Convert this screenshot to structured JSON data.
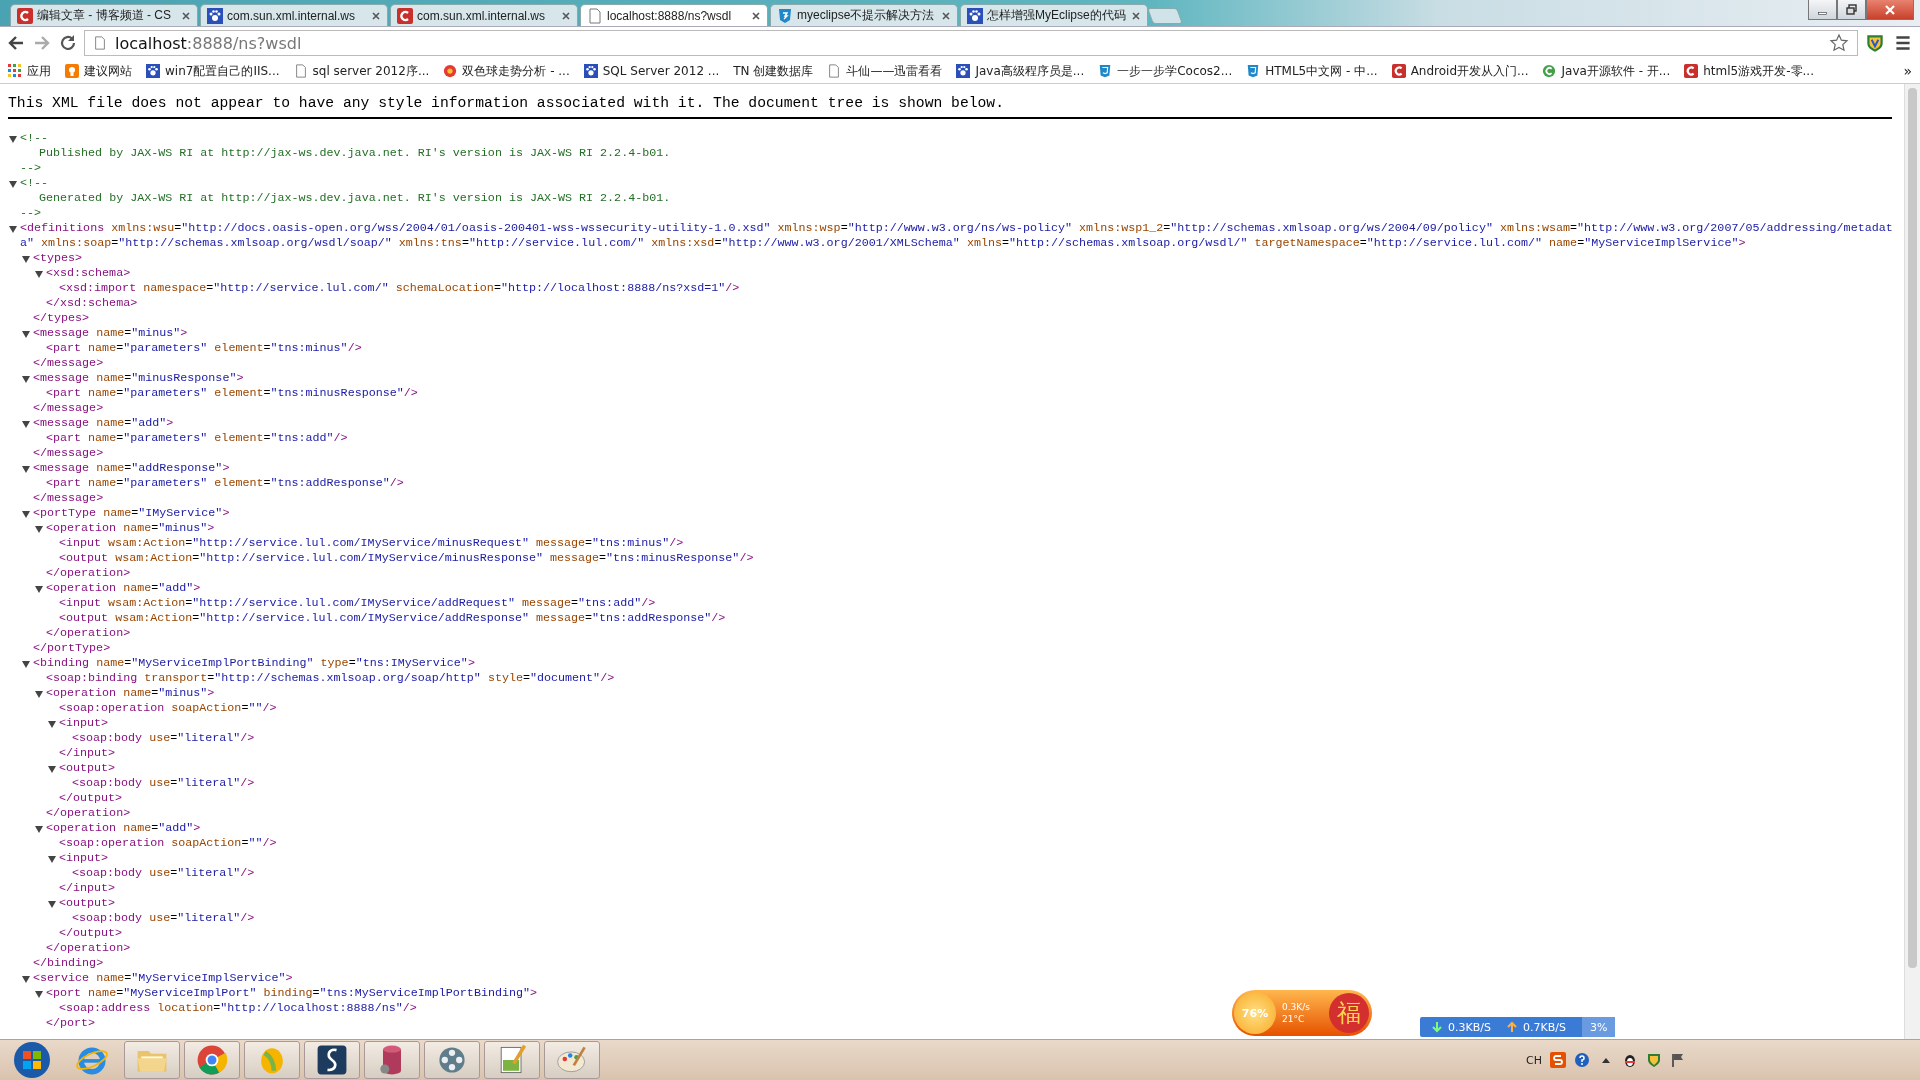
{
  "tabs": [
    {
      "title": "编辑文章 - 博客频道 - CS",
      "kind": "red-c",
      "selected": false
    },
    {
      "title": "com.sun.xml.internal.ws",
      "kind": "paw",
      "selected": false
    },
    {
      "title": "com.sun.xml.internal.ws",
      "kind": "red-c",
      "selected": false
    },
    {
      "title": "localhost:8888/ns?wsdl",
      "kind": "page",
      "selected": true
    },
    {
      "title": "myeclipse不提示解决方法",
      "kind": "blue-3",
      "selected": false
    },
    {
      "title": "怎样增强MyEclipse的代码",
      "kind": "paw",
      "selected": false
    }
  ],
  "address": {
    "host": "localhost",
    "rest": ":8888/ns?wsdl"
  },
  "bookmarks": [
    {
      "label": "应用",
      "kind": "apps"
    },
    {
      "label": "建议网站",
      "kind": "bulb"
    },
    {
      "label": "win7配置自己的IIS...",
      "kind": "paw"
    },
    {
      "label": "sql server 2012序...",
      "kind": "page"
    },
    {
      "label": "双色球走势分析 - ...",
      "kind": "ball"
    },
    {
      "label": "SQL Server 2012 ...",
      "kind": "paw"
    },
    {
      "label": "TN 创建数据库",
      "kind": "none"
    },
    {
      "label": "斗仙——迅雷看看",
      "kind": "page"
    },
    {
      "label": "Java高级程序员是...",
      "kind": "paw"
    },
    {
      "label": "一步一步学Cocos2...",
      "kind": "html5"
    },
    {
      "label": "HTML5中文网 - 中...",
      "kind": "html5"
    },
    {
      "label": "Android开发从入门...",
      "kind": "red-c"
    },
    {
      "label": "Java开源软件 - 开...",
      "kind": "green-c"
    },
    {
      "label": "html5游戏开发-零...",
      "kind": "red-c"
    }
  ],
  "bookmarks_more": "»",
  "notice": "This XML file does not appear to have any style information associated with it. The document tree is shown below.",
  "xml": [
    {
      "kind": "comment",
      "expanded": true,
      "open": "<!--",
      "text": "Published by JAX-WS RI at http://jax-ws.dev.java.net. RI's version is JAX-WS RI 2.2.4-b01.",
      "close": "-->"
    },
    {
      "kind": "comment",
      "expanded": true,
      "open": "<!--",
      "text": "Generated by JAX-WS RI at http://jax-ws.dev.java.net. RI's version is JAX-WS RI 2.2.4-b01.",
      "close": "-->"
    },
    {
      "kind": "element",
      "expanded": true,
      "open": "<definitions xmlns:wsu=\"http://docs.oasis-open.org/wss/2004/01/oasis-200401-wss-wssecurity-utility-1.0.xsd\" xmlns:wsp=\"http://www.w3.org/ns/ws-policy\" xmlns:wsp1_2=\"http://schemas.xmlsoap.org/ws/2004/09/policy\" xmlns:wsam=\"http://www.w3.org/2007/05/addressing/metadata\" xmlns:soap=\"http://schemas.xmlsoap.org/wsdl/soap/\" xmlns:tns=\"http://service.lul.com/\" xmlns:xsd=\"http://www.w3.org/2001/XMLSchema\" xmlns=\"http://schemas.xmlsoap.org/wsdl/\" targetNamespace=\"http://service.lul.com/\" name=\"MyServiceImplService\">",
      "children": [
        {
          "kind": "element",
          "expanded": true,
          "open": "<types>",
          "close": "</types>",
          "children": [
            {
              "kind": "element",
              "expanded": true,
              "open": "<xsd:schema>",
              "close": "</xsd:schema>",
              "children": [
                {
                  "kind": "leaf",
                  "text": "<xsd:import namespace=\"http://service.lul.com/\" schemaLocation=\"http://localhost:8888/ns?xsd=1\"/>"
                }
              ]
            }
          ]
        },
        {
          "kind": "element",
          "expanded": true,
          "open": "<message name=\"minus\">",
          "close": "</message>",
          "children": [
            {
              "kind": "leaf",
              "text": "<part name=\"parameters\" element=\"tns:minus\"/>"
            }
          ]
        },
        {
          "kind": "element",
          "expanded": true,
          "open": "<message name=\"minusResponse\">",
          "close": "</message>",
          "children": [
            {
              "kind": "leaf",
              "text": "<part name=\"parameters\" element=\"tns:minusResponse\"/>"
            }
          ]
        },
        {
          "kind": "element",
          "expanded": true,
          "open": "<message name=\"add\">",
          "close": "</message>",
          "children": [
            {
              "kind": "leaf",
              "text": "<part name=\"parameters\" element=\"tns:add\"/>"
            }
          ]
        },
        {
          "kind": "element",
          "expanded": true,
          "open": "<message name=\"addResponse\">",
          "close": "</message>",
          "children": [
            {
              "kind": "leaf",
              "text": "<part name=\"parameters\" element=\"tns:addResponse\"/>"
            }
          ]
        },
        {
          "kind": "element",
          "expanded": true,
          "open": "<portType name=\"IMyService\">",
          "close": "</portType>",
          "children": [
            {
              "kind": "element",
              "expanded": true,
              "open": "<operation name=\"minus\">",
              "close": "</operation>",
              "children": [
                {
                  "kind": "leaf",
                  "text": "<input wsam:Action=\"http://service.lul.com/IMyService/minusRequest\" message=\"tns:minus\"/>"
                },
                {
                  "kind": "leaf",
                  "text": "<output wsam:Action=\"http://service.lul.com/IMyService/minusResponse\" message=\"tns:minusResponse\"/>"
                }
              ]
            },
            {
              "kind": "element",
              "expanded": true,
              "open": "<operation name=\"add\">",
              "close": "</operation>",
              "children": [
                {
                  "kind": "leaf",
                  "text": "<input wsam:Action=\"http://service.lul.com/IMyService/addRequest\" message=\"tns:add\"/>"
                },
                {
                  "kind": "leaf",
                  "text": "<output wsam:Action=\"http://service.lul.com/IMyService/addResponse\" message=\"tns:addResponse\"/>"
                }
              ]
            }
          ]
        },
        {
          "kind": "element",
          "expanded": true,
          "open": "<binding name=\"MyServiceImplPortBinding\" type=\"tns:IMyService\">",
          "close": "</binding>",
          "children": [
            {
              "kind": "leaf",
              "text": "<soap:binding transport=\"http://schemas.xmlsoap.org/soap/http\" style=\"document\"/>"
            },
            {
              "kind": "element",
              "expanded": true,
              "open": "<operation name=\"minus\">",
              "close": "</operation>",
              "children": [
                {
                  "kind": "leaf",
                  "text": "<soap:operation soapAction=\"\"/>"
                },
                {
                  "kind": "element",
                  "expanded": true,
                  "open": "<input>",
                  "close": "</input>",
                  "children": [
                    {
                      "kind": "leaf",
                      "text": "<soap:body use=\"literal\"/>"
                    }
                  ]
                },
                {
                  "kind": "element",
                  "expanded": true,
                  "open": "<output>",
                  "close": "</output>",
                  "children": [
                    {
                      "kind": "leaf",
                      "text": "<soap:body use=\"literal\"/>"
                    }
                  ]
                }
              ]
            },
            {
              "kind": "element",
              "expanded": true,
              "open": "<operation name=\"add\">",
              "close": "</operation>",
              "children": [
                {
                  "kind": "leaf",
                  "text": "<soap:operation soapAction=\"\"/>"
                },
                {
                  "kind": "element",
                  "expanded": true,
                  "open": "<input>",
                  "close": "</input>",
                  "children": [
                    {
                      "kind": "leaf",
                      "text": "<soap:body use=\"literal\"/>"
                    }
                  ]
                },
                {
                  "kind": "element",
                  "expanded": true,
                  "open": "<output>",
                  "close": "</output>",
                  "children": [
                    {
                      "kind": "leaf",
                      "text": "<soap:body use=\"literal\"/>"
                    }
                  ]
                }
              ]
            }
          ]
        },
        {
          "kind": "element",
          "expanded": true,
          "open": "<service name=\"MyServiceImplService\">",
          "children": [
            {
              "kind": "element",
              "expanded": true,
              "open": "<port name=\"MyServiceImplPort\" binding=\"tns:MyServiceImplPortBinding\">",
              "close": "</port>",
              "children": [
                {
                  "kind": "leaf",
                  "text": "<soap:address location=\"http://localhost:8888/ns\"/>"
                }
              ]
            }
          ]
        }
      ]
    }
  ],
  "widget": {
    "percent": "76%",
    "speed": "0.3K/s",
    "temp": "21°C",
    "charm": "福"
  },
  "netbar": {
    "down": "0.3KB/S",
    "up": "0.7KB/S",
    "cpu": "3%"
  },
  "taskbar": [
    {
      "kind": "start",
      "open": false
    },
    {
      "kind": "ie",
      "open": false
    },
    {
      "kind": "folder",
      "open": true
    },
    {
      "kind": "chrome",
      "open": true
    },
    {
      "kind": "green",
      "open": true
    },
    {
      "kind": "curve",
      "open": true
    },
    {
      "kind": "database",
      "open": true
    },
    {
      "kind": "reel",
      "open": true
    },
    {
      "kind": "notepad",
      "open": true
    },
    {
      "kind": "paint",
      "open": true
    }
  ],
  "tray": {
    "lang": "CH"
  }
}
